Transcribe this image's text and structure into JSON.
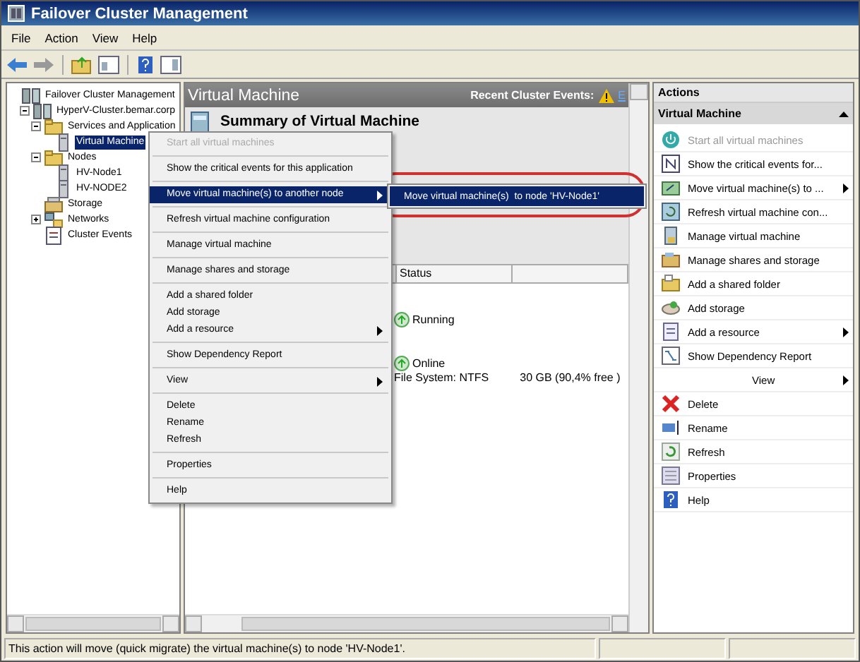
{
  "window": {
    "title": "Failover Cluster Management"
  },
  "menu": [
    "File",
    "Action",
    "View",
    "Help"
  ],
  "tree": [
    {
      "label": "Failover Cluster Management",
      "selected": false,
      "children": [
        {
          "label": "HyperV-Cluster.bemar.corp",
          "expanded": true,
          "selected": false,
          "children": [
            {
              "label": "Services and Application",
              "expanded": true,
              "selected": false,
              "children": [
                {
                  "label": "Virtual Machine",
                  "selected": true
                }
              ]
            },
            {
              "label": "Nodes",
              "expanded": true,
              "selected": false,
              "children": [
                {
                  "label": "HV-Node1",
                  "selected": false
                },
                {
                  "label": "HV-NODE2",
                  "selected": false
                }
              ]
            },
            {
              "label": "Storage",
              "selected": false
            },
            {
              "label": "Networks",
              "expanded": false,
              "selected": false
            },
            {
              "label": "Cluster Events",
              "selected": false
            }
          ]
        }
      ]
    }
  ],
  "center": {
    "title": "Virtual Machine",
    "events_label": "Recent Cluster Events:",
    "events_link": "E",
    "summary_title": "Summary of Virtual Machine",
    "columns": [
      "Status"
    ],
    "rows": [
      {
        "kind": "status",
        "text": "Running"
      },
      {
        "kind": "status",
        "text": "Online"
      },
      {
        "kind": "detail",
        "cells": [
          "File System: NTFS",
          "30 GB (90,4% free )"
        ]
      }
    ]
  },
  "context_menu": {
    "items": [
      {
        "kind": "item",
        "label": "Start all virtual machines",
        "disabled": true,
        "selected": false,
        "submenu": false
      },
      {
        "kind": "separator"
      },
      {
        "kind": "item",
        "label": "Show the critical events for this application",
        "disabled": false,
        "selected": false,
        "submenu": false
      },
      {
        "kind": "separator"
      },
      {
        "kind": "item",
        "label": "Move virtual machine(s) to another node",
        "disabled": false,
        "selected": true,
        "submenu": true
      },
      {
        "kind": "separator"
      },
      {
        "kind": "item",
        "label": "Refresh virtual machine configuration",
        "disabled": false,
        "selected": false,
        "submenu": false
      },
      {
        "kind": "separator"
      },
      {
        "kind": "item",
        "label": "Manage virtual machine",
        "disabled": false,
        "selected": false,
        "submenu": false
      },
      {
        "kind": "separator"
      },
      {
        "kind": "item",
        "label": "Manage shares and storage",
        "disabled": false,
        "selected": false,
        "submenu": false
      },
      {
        "kind": "separator"
      },
      {
        "kind": "item",
        "label": "Add a shared folder",
        "disabled": false,
        "selected": false,
        "submenu": false
      },
      {
        "kind": "item",
        "label": "Add storage",
        "disabled": false,
        "selected": false,
        "submenu": false
      },
      {
        "kind": "item",
        "label": "Add a resource",
        "disabled": false,
        "selected": false,
        "submenu": true
      },
      {
        "kind": "separator"
      },
      {
        "kind": "item",
        "label": "Show Dependency Report",
        "disabled": false,
        "selected": false,
        "submenu": false
      },
      {
        "kind": "separator"
      },
      {
        "kind": "item",
        "label": "View",
        "disabled": false,
        "selected": false,
        "submenu": true
      },
      {
        "kind": "separator"
      },
      {
        "kind": "item",
        "label": "Delete",
        "disabled": false,
        "selected": false,
        "submenu": false
      },
      {
        "kind": "item",
        "label": "Rename",
        "disabled": false,
        "selected": false,
        "submenu": false
      },
      {
        "kind": "item",
        "label": "Refresh",
        "disabled": false,
        "selected": false,
        "submenu": false
      },
      {
        "kind": "separator"
      },
      {
        "kind": "item",
        "label": "Properties",
        "disabled": false,
        "selected": false,
        "submenu": false
      },
      {
        "kind": "separator"
      },
      {
        "kind": "item",
        "label": "Help",
        "disabled": false,
        "selected": false,
        "submenu": false
      }
    ]
  },
  "submenu": {
    "items": [
      {
        "label": "Move virtual machine(s)  to node 'HV-Node1'",
        "selected": true
      }
    ]
  },
  "actions": {
    "title": "Actions",
    "section": "Virtual Machine",
    "expanded": true,
    "items": [
      {
        "label": "Start all virtual machines",
        "disabled": true,
        "submenu": false
      },
      {
        "label": "Show the critical events for...",
        "disabled": false,
        "submenu": false
      },
      {
        "label": "Move virtual machine(s) to ...",
        "disabled": false,
        "submenu": true
      },
      {
        "label": "Refresh virtual machine con...",
        "disabled": false,
        "submenu": false
      },
      {
        "label": "Manage virtual machine",
        "disabled": false,
        "submenu": false
      },
      {
        "label": "Manage shares and storage",
        "disabled": false,
        "submenu": false
      },
      {
        "label": "Add a shared folder",
        "disabled": false,
        "submenu": false
      },
      {
        "label": "Add storage",
        "disabled": false,
        "submenu": false
      },
      {
        "label": "Add a resource",
        "disabled": false,
        "submenu": true
      },
      {
        "label": "Show Dependency Report",
        "disabled": false,
        "submenu": false
      },
      {
        "label": "View",
        "disabled": false,
        "submenu": true
      },
      {
        "label": "Delete",
        "disabled": false,
        "submenu": false
      },
      {
        "label": "Rename",
        "disabled": false,
        "submenu": false
      },
      {
        "label": "Refresh",
        "disabled": false,
        "submenu": false
      },
      {
        "label": "Properties",
        "disabled": false,
        "submenu": false
      },
      {
        "label": "Help",
        "disabled": false,
        "submenu": false
      }
    ]
  },
  "status_bar": {
    "text": "This action will move (quick migrate) the virtual machine(s) to node 'HV-Node1'."
  }
}
